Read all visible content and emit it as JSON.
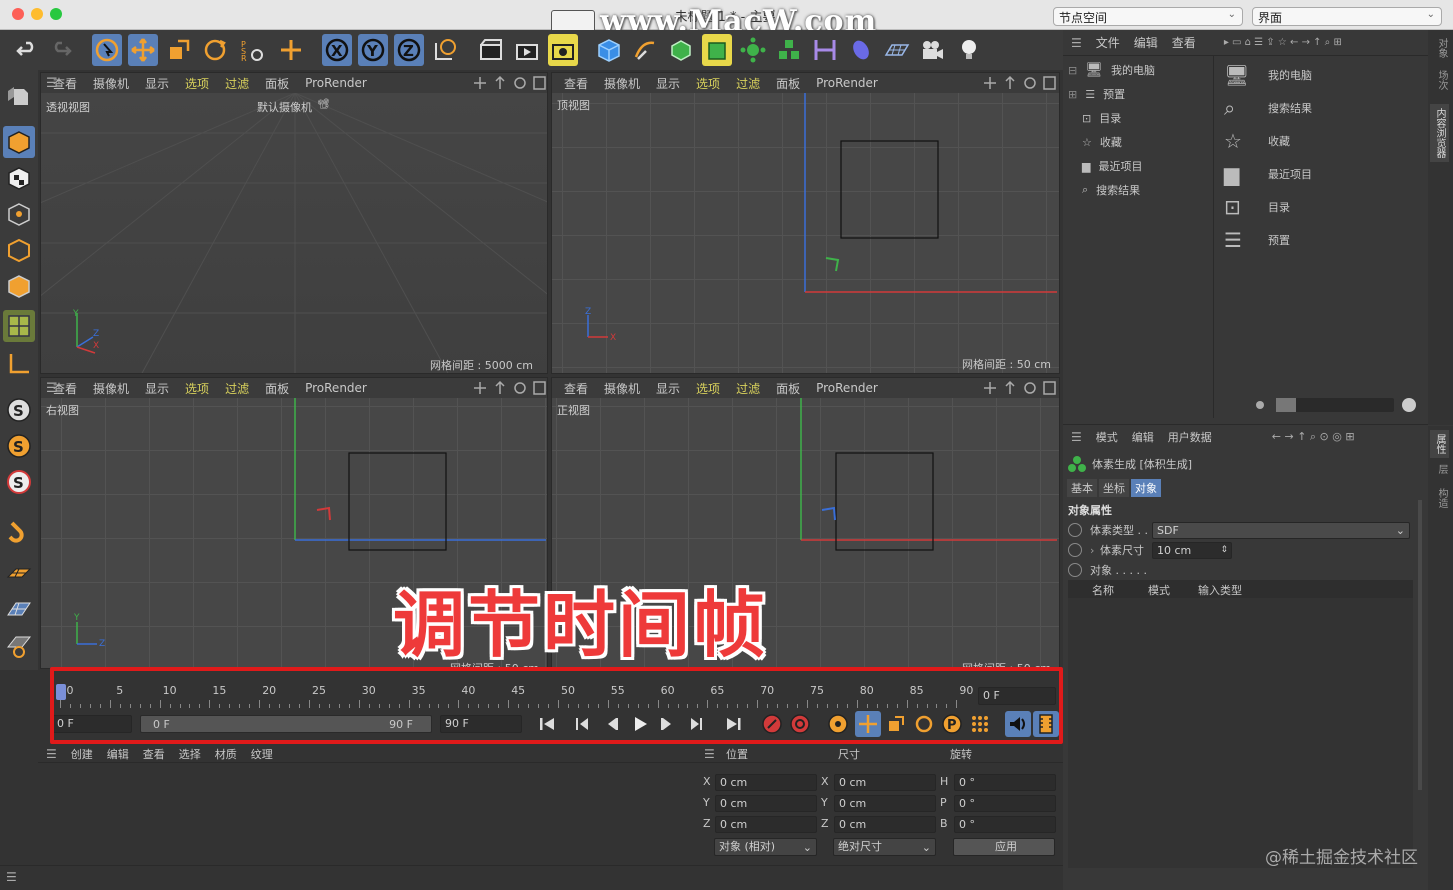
{
  "window": {
    "title": "未标题 1 * - 主要",
    "watermark": "www.MacW.com",
    "node_space_label": "节点空间",
    "layout_label": "界面"
  },
  "viewport_menu": [
    "查看",
    "摄像机",
    "显示",
    "选项",
    "过滤",
    "面板",
    "ProRender"
  ],
  "viewports": {
    "perspective": {
      "label": "透视视图",
      "camera": "默认摄像机",
      "grid": "网格间距 : 5000 cm",
      "axis_y": "Y",
      "axis_z": "Z",
      "axis_x": "X"
    },
    "top": {
      "label": "顶视图",
      "grid": "网格间距 : 50 cm",
      "axis_a": "Z",
      "axis_b": "X"
    },
    "right": {
      "label": "右视图",
      "grid": "网格间距 : 50 cm",
      "axis_a": "Y",
      "axis_b": "Z"
    },
    "front": {
      "label": "正视图",
      "grid": "网格间距 : 50 cm"
    }
  },
  "overlay_caption": "调节时间帧",
  "credit": "@稀土掘金技术社区",
  "browser": {
    "menu": [
      "文件",
      "编辑",
      "查看"
    ],
    "tree": [
      "我的电脑",
      "预置",
      "目录",
      "收藏",
      "最近项目",
      "搜索结果"
    ],
    "list": [
      "我的电脑",
      "搜索结果",
      "收藏",
      "最近项目",
      "目录",
      "预置"
    ]
  },
  "side_tabs": {
    "top": [
      "对象",
      "场次",
      "内容浏览器"
    ],
    "bottom": [
      "属性",
      "层",
      "构造"
    ]
  },
  "attributes": {
    "menu": [
      "模式",
      "编辑",
      "用户数据"
    ],
    "object_title": "体素生成 [体积生成]",
    "tabs": [
      "基本",
      "坐标",
      "对象"
    ],
    "active_tab": "对象",
    "section": "对象属性",
    "voxel_type_label": "体素类型 . .",
    "voxel_type_value": "SDF",
    "voxel_size_label": "体素尺寸",
    "voxel_size_value": "10 cm",
    "objects_label": "对象 . . . . .",
    "columns": [
      "名称",
      "模式",
      "输入类型"
    ]
  },
  "timeline": {
    "ticks": [
      "0",
      "5",
      "10",
      "15",
      "20",
      "25",
      "30",
      "35",
      "40",
      "45",
      "50",
      "55",
      "60",
      "65",
      "70",
      "75",
      "80",
      "85",
      "90"
    ],
    "current_frame": "0 F",
    "start_field": "0 F",
    "range_start": "0 F",
    "range_end": "90 F",
    "end_field": "90 F"
  },
  "material_menu": [
    "创建",
    "编辑",
    "查看",
    "选择",
    "材质",
    "纹理"
  ],
  "coords": {
    "headers": [
      "位置",
      "尺寸",
      "旋转"
    ],
    "rows": [
      {
        "pl": "X",
        "p": "0 cm",
        "sl": "X",
        "s": "0 cm",
        "rl": "H",
        "r": "0 °"
      },
      {
        "pl": "Y",
        "p": "0 cm",
        "sl": "Y",
        "s": "0 cm",
        "rl": "P",
        "r": "0 °"
      },
      {
        "pl": "Z",
        "p": "0 cm",
        "sl": "Z",
        "s": "0 cm",
        "rl": "B",
        "r": "0 °"
      }
    ],
    "mode": "对象 (相对)",
    "size_mode": "绝对尺寸",
    "apply": "应用"
  },
  "colors": {
    "accent_orange": "#f0a030",
    "highlight_yellow": "#d8d15c",
    "axis_red": "#d23a3a",
    "axis_green": "#3fb24a",
    "axis_blue": "#3a6fd8",
    "frame_red": "#e01a1a"
  }
}
